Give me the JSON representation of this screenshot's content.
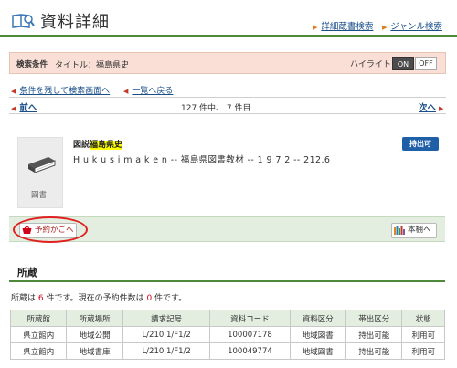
{
  "header": {
    "title": "資料詳細",
    "links": [
      "詳細蔵書検索",
      "ジャンル検索"
    ]
  },
  "search_condition": {
    "label": "検索条件",
    "text": "タイトル：福島県史",
    "highlight_label": "ハイライト：",
    "on": "ON",
    "off": "OFF"
  },
  "nav": {
    "back_to_search": "条件を残して検索画面へ",
    "back_to_list": "一覧へ戻る",
    "prev": "前へ",
    "next": "次へ",
    "position": "127 件中、 7 件目"
  },
  "item": {
    "image_caption": "図書",
    "title_prefix": "図説",
    "title_highlight": "福島県史",
    "info": "H u k u s i m a k e n  -- 福島県図書教材 -- 1 9 7 2 -- 212.6",
    "badge": "持出可"
  },
  "actions": {
    "reserve": "予約かごへ",
    "shelf": "本棚へ"
  },
  "holdings": {
    "heading": "所蔵",
    "summary_prefix": "所蔵は ",
    "count": "6",
    "summary_mid": " 件です。現在の予約件数は ",
    "reservations": "0",
    "summary_suffix": " 件です。",
    "columns": [
      "所蔵館",
      "所蔵場所",
      "請求記号",
      "資料コード",
      "資料区分",
      "帯出区分",
      "状態"
    ],
    "rows": [
      [
        "県立館内",
        "地域公開",
        "L/210.1/F1/2",
        "100007178",
        "地域図書",
        "持出可能",
        "利用可"
      ],
      [
        "県立館内",
        "地域書庫",
        "L/210.1/F1/2",
        "100049774",
        "地域図書",
        "持出可能",
        "利用可"
      ]
    ]
  },
  "colors": {
    "accent_green": "#4e8a3a",
    "condition_bg": "#f9dfd5",
    "badge_blue": "#1f5fa8",
    "annotation_red": "#e02020",
    "highlight_yellow": "#ffff00"
  }
}
